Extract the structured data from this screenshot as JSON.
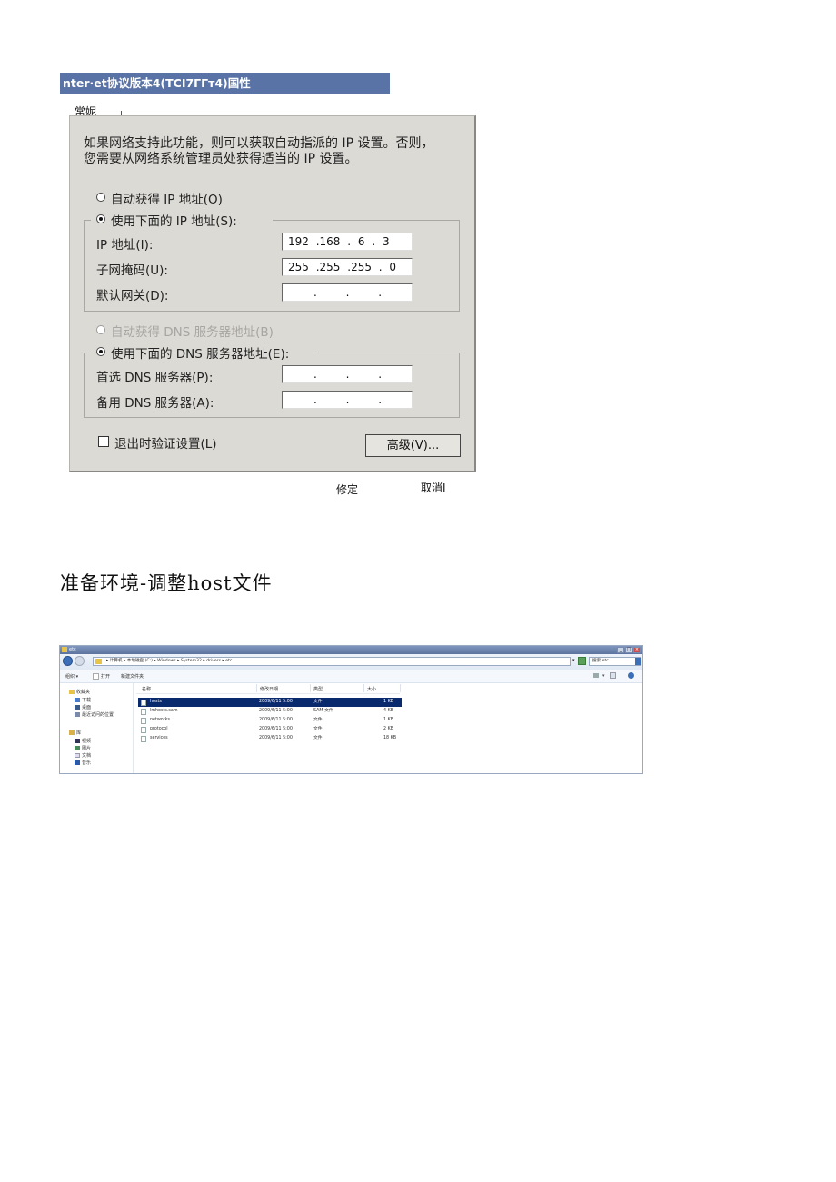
{
  "dialog": {
    "title": "nter·et协议版本4(TCI7ΓΓт4)国性",
    "tab": "常妮",
    "description_line1": "如果网络支持此功能，则可以获取自动指派的 IP 设置。否则，",
    "description_line2": "您需要从网络系统管理员处获得适当的 IP 设置。",
    "ip_auto_label": "自动获得 IP 地址(O)",
    "ip_manual_label": "使用下面的 IP 地址(S):",
    "ip_address_label": "IP 地址(I):",
    "ip_address_value": "192 .168 . 6 . 3",
    "subnet_label": "子网掩码(U):",
    "subnet_value": "255 .255 .255 . 0",
    "gateway_label": "默认网关(D):",
    "gateway_value": ". . .",
    "dns_auto_label": "自动获得 DNS 服务器地址(B)",
    "dns_manual_label": "使用下面的 DNS 服务器地址(E):",
    "preferred_dns_label": "首选 DNS 服务器(P):",
    "preferred_dns_value": ". . .",
    "alternate_dns_label": "备用 DNS 服务器(A):",
    "alternate_dns_value": ". . .",
    "validate_label": "退出时验证设置(L)",
    "advanced_button": "高级(V)...",
    "ok_button": "修定",
    "cancel_button": "取消I"
  },
  "section_heading": "准备环境-调整host文件",
  "explorer": {
    "title": "etc",
    "address": "▸ 计算机 ▸ 本地磁盘 (C:) ▸ Windows ▸ System32 ▸ drivers ▸ etc",
    "search_placeholder": "搜索 etc",
    "toolbar": [
      "组织 ▾",
      "打开",
      "新建文件夹"
    ],
    "sidebar": {
      "favorites": "收藏夹",
      "favorites_items": [
        "下载",
        "桌面",
        "最近访问的位置"
      ],
      "libraries": "库",
      "library_items": [
        "视频",
        "图片",
        "文档",
        "音乐"
      ]
    },
    "columns": [
      "名称",
      "修改日期",
      "类型",
      "大小"
    ],
    "files": [
      {
        "name": "hosts",
        "date": "2009/6/11 5:00",
        "type": "文件",
        "size": "1 KB"
      },
      {
        "name": "lmhosts.sam",
        "date": "2009/6/11 5:00",
        "type": "SAM 文件",
        "size": "4 KB"
      },
      {
        "name": "networks",
        "date": "2009/6/11 5:00",
        "type": "文件",
        "size": "1 KB"
      },
      {
        "name": "protocol",
        "date": "2009/6/11 5:00",
        "type": "文件",
        "size": "2 KB"
      },
      {
        "name": "services",
        "date": "2009/6/11 5:00",
        "type": "文件",
        "size": "18 KB"
      }
    ],
    "colors": {
      "titlebar": "#5b739e",
      "selection": "#0a2a6e"
    }
  }
}
